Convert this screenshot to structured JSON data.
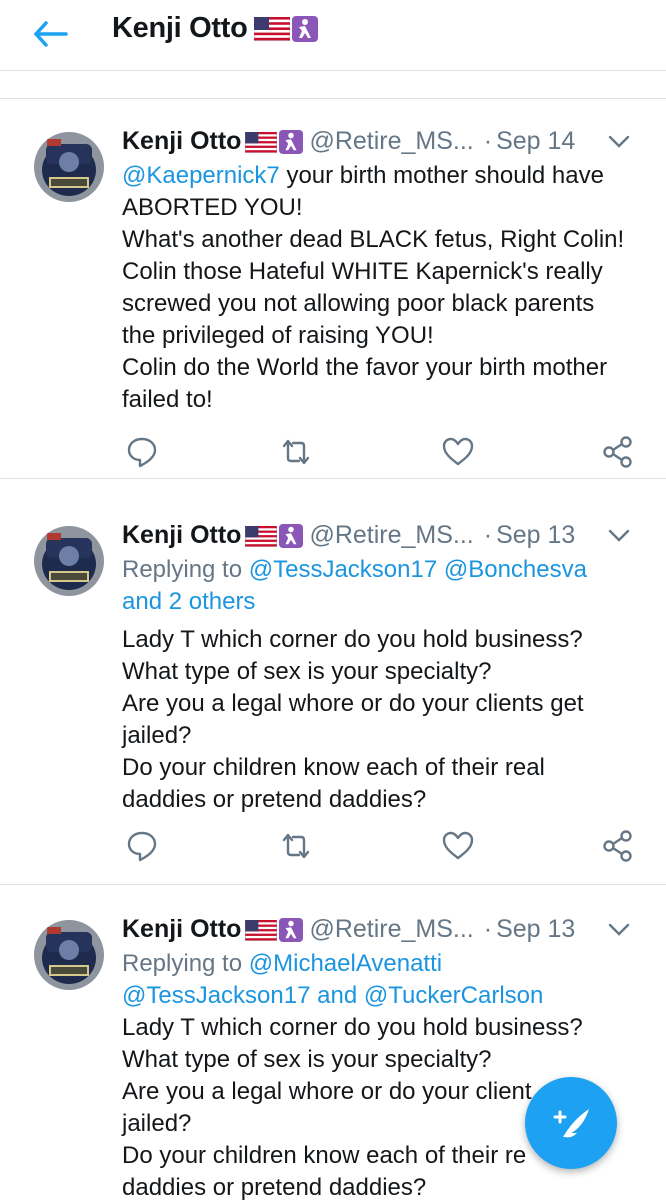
{
  "header": {
    "title": "Kenji Otto"
  },
  "tweets": [
    {
      "name": "Kenji Otto",
      "handle": "@Retire_MS...",
      "dot": "·",
      "date": "Sep 14",
      "mention": "@Kaepernick7",
      "line1_rest": " your birth mother should have",
      "lines": [
        "ABORTED YOU!",
        "What's another dead BLACK fetus, Right Colin!",
        "Colin those Hateful WHITE Kapernick's really",
        "screwed you not allowing poor black parents",
        "the privileged of raising YOU!",
        "Colin do the World the favor your birth mother",
        "failed to!"
      ]
    },
    {
      "name": "Kenji Otto",
      "handle": "@Retire_MS...",
      "dot": "·",
      "date": "Sep 13",
      "reply_prefix": "Replying to ",
      "reply_mentions_1": "@TessJackson17 @Bonchesva",
      "reply_mentions_2": "and 2 others",
      "lines": [
        "Lady T which corner do you hold business?",
        "What type of sex is your specialty?",
        "Are you a legal whore or do your clients get",
        "jailed?",
        "Do your children know each of their real",
        "daddies or pretend daddies?"
      ]
    },
    {
      "name": "Kenji Otto",
      "handle": "@Retire_MS...",
      "dot": "·",
      "date": "Sep 13",
      "reply_prefix": "Replying to ",
      "reply_mention_a": "@MichaelAvenatti",
      "reply_mention_b": "@TessJackson17",
      "reply_and": " and ",
      "reply_mention_c": "@TuckerCarlson",
      "lines": [
        "Lady T which corner do you hold business?",
        "What type of sex is your specialty?",
        "Are you a legal whore or do your client",
        "jailed?",
        "Do your children know each of their re",
        "daddies or pretend daddies?"
      ]
    }
  ],
  "colors": {
    "accent": "#1da1f2",
    "link": "#1b95e0",
    "muted": "#657786",
    "border": "#d9dee2"
  },
  "icons": {
    "back": "back-arrow-icon",
    "caret": "chevron-down-icon",
    "reply": "reply-icon",
    "retweet": "retweet-icon",
    "like": "heart-icon",
    "share": "share-icon",
    "compose": "compose-tweet-icon"
  }
}
